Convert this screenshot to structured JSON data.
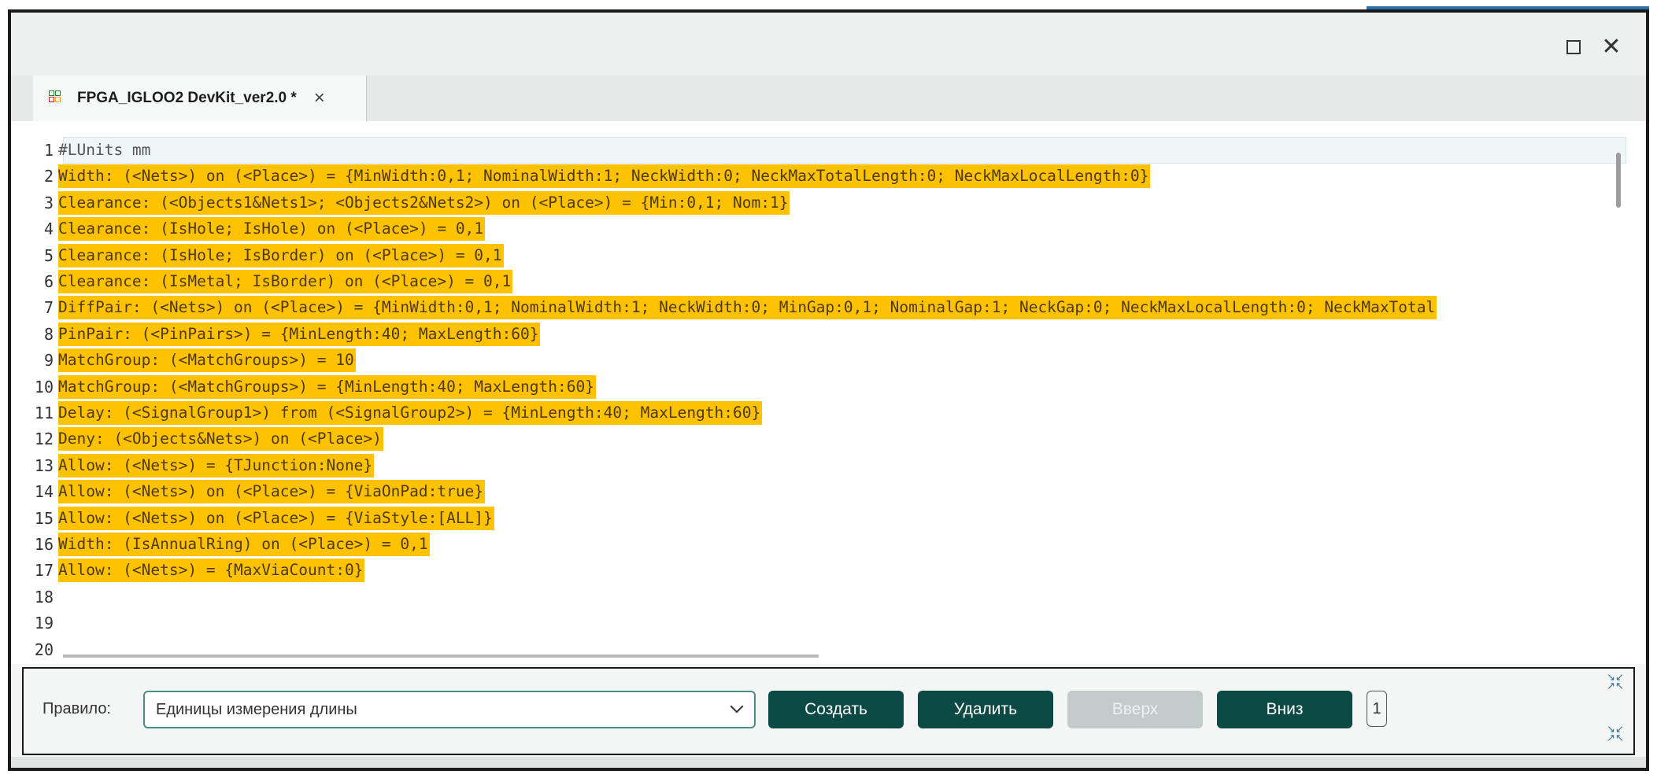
{
  "window": {
    "maximize_icon": "maximize-icon",
    "close_glyph": "✕"
  },
  "tab": {
    "title": "FPGA_IGLOO2 DevKit_ver2.0 *",
    "close_glyph": "×"
  },
  "editor": {
    "lines": [
      {
        "n": "1",
        "text": "#LUnits mm",
        "highlight": false
      },
      {
        "n": "2",
        "text": "Width: (<Nets>) on (<Place>) = {MinWidth:0,1; NominalWidth:1; NeckWidth:0; NeckMaxTotalLength:0; NeckMaxLocalLength:0}",
        "highlight": true
      },
      {
        "n": "3",
        "text": "Clearance: (<Objects1&Nets1>; <Objects2&Nets2>) on (<Place>) = {Min:0,1; Nom:1}",
        "highlight": true
      },
      {
        "n": "4",
        "text": "Clearance: (IsHole; IsHole) on (<Place>) = 0,1",
        "highlight": true
      },
      {
        "n": "5",
        "text": "Clearance: (IsHole; IsBorder) on (<Place>) = 0,1",
        "highlight": true
      },
      {
        "n": "6",
        "text": "Clearance: (IsMetal; IsBorder) on (<Place>) = 0,1",
        "highlight": true
      },
      {
        "n": "7",
        "text": "DiffPair: (<Nets>) on (<Place>) = {MinWidth:0,1; NominalWidth:1; NeckWidth:0; MinGap:0,1; NominalGap:1; NeckGap:0; NeckMaxLocalLength:0; NeckMaxTotal",
        "highlight": true
      },
      {
        "n": "8",
        "text": "PinPair: (<PinPairs>) = {MinLength:40; MaxLength:60}",
        "highlight": true
      },
      {
        "n": "9",
        "text": "MatchGroup: (<MatchGroups>) = 10",
        "highlight": true
      },
      {
        "n": "10",
        "text": "MatchGroup: (<MatchGroups>) = {MinLength:40; MaxLength:60}",
        "highlight": true
      },
      {
        "n": "11",
        "text": "Delay: (<SignalGroup1>) from (<SignalGroup2>) = {MinLength:40; MaxLength:60}",
        "highlight": true
      },
      {
        "n": "12",
        "text": "Deny: (<Objects&Nets>) on (<Place>)",
        "highlight": true
      },
      {
        "n": "13",
        "text": "Allow: (<Nets>) = {TJunction:None}",
        "highlight": true
      },
      {
        "n": "14",
        "text": "Allow: (<Nets>) on (<Place>) = {ViaOnPad:true}",
        "highlight": true
      },
      {
        "n": "15",
        "text": "Allow: (<Nets>) on (<Place>) = {ViaStyle:[ALL]}",
        "highlight": true
      },
      {
        "n": "16",
        "text": "Width: (IsAnnualRing) on (<Place>) = 0,1",
        "highlight": true
      },
      {
        "n": "17",
        "text": "Allow: (<Nets>) = {MaxViaCount:0}",
        "highlight": true
      },
      {
        "n": "18",
        "text": "",
        "highlight": false
      },
      {
        "n": "19",
        "text": "",
        "highlight": false
      },
      {
        "n": "20",
        "text": "",
        "highlight": false
      }
    ]
  },
  "rule_bar": {
    "label": "Правило:",
    "selected": "Единицы измерения длины",
    "buttons": {
      "create": "Создать",
      "delete": "Удалить",
      "up": "Вверх",
      "down": "Вниз"
    },
    "counter": "1"
  },
  "colors": {
    "highlight": "#ffc200",
    "button": "#0b4a44",
    "button_disabled": "#c4cbcb"
  }
}
